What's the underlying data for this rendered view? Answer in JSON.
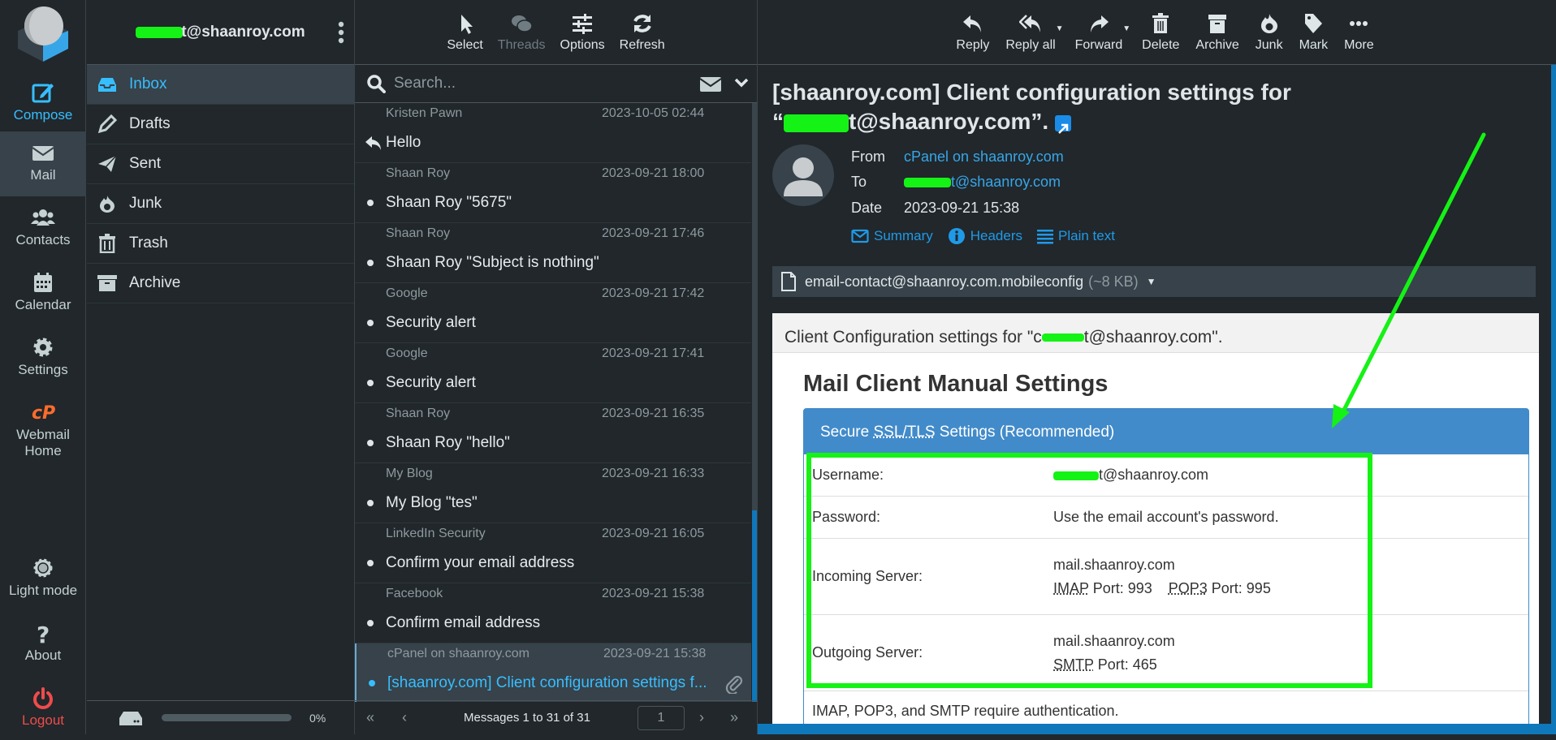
{
  "nav": {
    "items": [
      {
        "label": "Compose",
        "icon": "compose-icon"
      },
      {
        "label": "Mail",
        "icon": "mail-icon"
      },
      {
        "label": "Contacts",
        "icon": "contacts-icon"
      },
      {
        "label": "Calendar",
        "icon": "calendar-icon"
      },
      {
        "label": "Settings",
        "icon": "gear-icon"
      },
      {
        "label": "Webmail Home",
        "icon": "cpanel-icon"
      },
      {
        "label": "Light mode",
        "icon": "sun-icon"
      },
      {
        "label": "About",
        "icon": "question-icon"
      },
      {
        "label": "Logout",
        "icon": "power-icon"
      }
    ]
  },
  "account": {
    "email_suffix": "t@shaanroy.com"
  },
  "folders": [
    {
      "label": "Inbox",
      "icon": "inbox-icon"
    },
    {
      "label": "Drafts",
      "icon": "pencil-icon"
    },
    {
      "label": "Sent",
      "icon": "paper-plane-icon"
    },
    {
      "label": "Junk",
      "icon": "fire-icon"
    },
    {
      "label": "Trash",
      "icon": "trash-icon"
    },
    {
      "label": "Archive",
      "icon": "archive-icon"
    }
  ],
  "quota": {
    "percent_label": "0%",
    "used_fraction": 0
  },
  "list_toolbar": {
    "select": "Select",
    "threads": "Threads",
    "options": "Options",
    "refresh": "Refresh"
  },
  "search": {
    "placeholder": "Search..."
  },
  "messages": [
    {
      "from": "Kristen Pawn",
      "date": "2023-10-05 02:44",
      "subject": "Hello",
      "status": "replied"
    },
    {
      "from": "Shaan Roy",
      "date": "2023-09-21 18:00",
      "subject": "Shaan Roy \"5675\"",
      "status": "read"
    },
    {
      "from": "Shaan Roy",
      "date": "2023-09-21 17:46",
      "subject": "Shaan Roy \"Subject is nothing\"",
      "status": "read"
    },
    {
      "from": "Google",
      "date": "2023-09-21 17:42",
      "subject": "Security alert",
      "status": "read"
    },
    {
      "from": "Google",
      "date": "2023-09-21 17:41",
      "subject": "Security alert",
      "status": "read"
    },
    {
      "from": "Shaan Roy",
      "date": "2023-09-21 16:35",
      "subject": "Shaan Roy \"hello\"",
      "status": "read"
    },
    {
      "from": "My Blog",
      "date": "2023-09-21 16:33",
      "subject": "My Blog \"tes\"",
      "status": "read"
    },
    {
      "from": "LinkedIn Security",
      "date": "2023-09-21 16:05",
      "subject": "Confirm your email address",
      "status": "read"
    },
    {
      "from": "Facebook",
      "date": "2023-09-21 15:38",
      "subject": "Confirm email address",
      "status": "read"
    },
    {
      "from": "cPanel on shaanroy.com",
      "date": "2023-09-21 15:38",
      "subject": "[shaanroy.com] Client configuration settings f...",
      "status": "selected",
      "attachment": true
    }
  ],
  "list_footer": {
    "count": "Messages 1 to 31 of 31",
    "page": "1"
  },
  "message_toolbar": {
    "reply": "Reply",
    "reply_all": "Reply all",
    "forward": "Forward",
    "delete": "Delete",
    "archive": "Archive",
    "junk": "Junk",
    "mark": "Mark",
    "more": "More"
  },
  "message": {
    "subject_line1": "[shaanroy.com] Client configuration settings for",
    "subject_line2_suffix": "t@shaanroy.com”.",
    "from_label": "From",
    "from": "cPanel on shaanroy.com",
    "to_label": "To",
    "to_suffix": "t@shaanroy.com",
    "date_label": "Date",
    "date": "2023-09-21 15:38",
    "links": {
      "summary": "Summary",
      "headers": "Headers",
      "plain_text": "Plain text"
    },
    "attachment": {
      "name": "email-contact@shaanroy.com.mobileconfig",
      "size": "(~8 KB)"
    }
  },
  "body": {
    "intro_prefix": "Client Configuration settings for \"c",
    "intro_suffix": "t@shaanroy.com\".",
    "heading": "Mail Client Manual Settings",
    "panel_title_pre": "Secure ",
    "panel_title_abbr": "SSL/TLS",
    "panel_title_post": " Settings (Recommended)",
    "rows": {
      "username_label": "Username:",
      "username_suffix": "t@shaanroy.com",
      "password_label": "Password:",
      "password_value": "Use the email account's password.",
      "incoming_label": "Incoming Server:",
      "incoming_host": "mail.shaanroy.com",
      "imap": "IMAP",
      "imap_port": " Port: 993",
      "pop3": "POP3",
      "pop3_port": " Port: 995",
      "outgoing_label": "Outgoing Server:",
      "outgoing_host": "mail.shaanroy.com",
      "smtp": "SMTP",
      "smtp_port": " Port: 465"
    },
    "note": "IMAP, POP3, and SMTP require authentication."
  },
  "colors": {
    "accent": "#37beff",
    "link": "#37a6e8",
    "highlight": "#15f215",
    "panel": "#428bca",
    "logout": "#ef4b4b",
    "cpanel": "#ff6c2c"
  }
}
